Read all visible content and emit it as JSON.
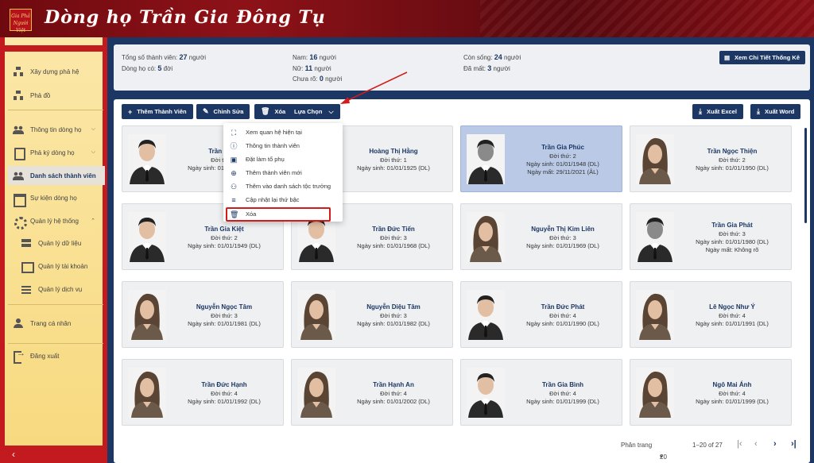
{
  "header": {
    "logo_text": "Gia Phả Người Việt",
    "title": "Dòng họ Trần Gia Đông Tụ"
  },
  "sidebar": {
    "items": [
      {
        "label": "Xây dựng phả hệ",
        "icon": "tree-icon"
      },
      {
        "label": "Phả đồ",
        "icon": "tree-icon"
      },
      {
        "label": "Thông tin dòng họ",
        "icon": "people-icon"
      },
      {
        "label": "Phả ký dòng họ",
        "icon": "book-icon"
      },
      {
        "label": "Danh sách thành viên",
        "icon": "people-icon"
      },
      {
        "label": "Sự kiện dòng họ",
        "icon": "calendar-icon"
      },
      {
        "label": "Quản lý hệ thống",
        "icon": "gear-icon"
      },
      {
        "label": "Quản lý dữ liệu",
        "icon": "server-icon"
      },
      {
        "label": "Quản lý tài khoản",
        "icon": "card-icon"
      },
      {
        "label": "Quản lý dịch vụ",
        "icon": "list-icon"
      },
      {
        "label": "Trang cá nhân",
        "icon": "user-icon"
      },
      {
        "label": "Đăng xuất",
        "icon": "logout-icon"
      }
    ],
    "active": "Danh sách thành viên"
  },
  "stats": {
    "total_label": "Tổng số thành viên:",
    "total_value": "27",
    "total_unit": "người",
    "gen_label": "Dòng họ có:",
    "gen_value": "5",
    "gen_unit": "đời",
    "male_label": "Nam:",
    "male_value": "16",
    "male_unit": "người",
    "female_label": "Nữ:",
    "female_value": "11",
    "female_unit": "người",
    "unknown_label": "Chưa rõ:",
    "unknown_value": "0",
    "unknown_unit": "người",
    "alive_label": "Còn sống:",
    "alive_value": "24",
    "alive_unit": "người",
    "dead_label": "Đã mất:",
    "dead_value": "3",
    "dead_unit": "người",
    "detail_button": "Xem Chi Tiết Thống Kê"
  },
  "toolbar": {
    "add": "Thêm Thành Viên",
    "edit": "Chỉnh Sửa",
    "delete": "Xóa",
    "options": "Lựa Chọn",
    "export_excel": "Xuất Excel",
    "export_word": "Xuất Word"
  },
  "dropdown": {
    "items": [
      "Xem quan hệ hiện tại",
      "Thông tin thành viên",
      "Đặt làm tổ phụ",
      "Thêm thành viên mới",
      "Thêm vào danh sách tộc trưởng",
      "Cập nhật lại thứ bậc",
      "Xóa"
    ],
    "highlighted": "Xóa"
  },
  "members": [
    {
      "name": "Trần Hùng",
      "gen": "Đời thứ: 1",
      "birth": "Ngày sinh: 01/01/1925 (DL)",
      "death": "",
      "gender": "male",
      "selected": false
    },
    {
      "name": "Hoàng Thị Hằng",
      "gen": "Đời thứ: 1",
      "birth": "Ngày sinh: 01/01/1925 (DL)",
      "death": "",
      "gender": "female",
      "selected": false
    },
    {
      "name": "Trần Gia Phúc",
      "gen": "Đời thứ: 2",
      "birth": "Ngày sinh: 01/01/1948 (DL)",
      "death": "Ngày mất: 29/11/2021 (ÂL)",
      "gender": "male-dead",
      "selected": true
    },
    {
      "name": "Trần Ngọc Thiện",
      "gen": "Đời thứ: 2",
      "birth": "Ngày sinh: 01/01/1950 (DL)",
      "death": "",
      "gender": "female",
      "selected": false
    },
    {
      "name": "Trần Gia Kiệt",
      "gen": "Đời thứ: 2",
      "birth": "Ngày sinh: 01/01/1949 (DL)",
      "death": "",
      "gender": "male",
      "selected": false
    },
    {
      "name": "Trần Đức Tiến",
      "gen": "Đời thứ: 3",
      "birth": "Ngày sinh: 01/01/1968 (DL)",
      "death": "",
      "gender": "male",
      "selected": false
    },
    {
      "name": "Nguyễn Thị Kim Liên",
      "gen": "Đời thứ: 3",
      "birth": "Ngày sinh: 01/01/1969 (DL)",
      "death": "",
      "gender": "female",
      "selected": false
    },
    {
      "name": "Trần Gia Phát",
      "gen": "Đời thứ: 3",
      "birth": "Ngày sinh: 01/01/1980 (DL)",
      "death": "Ngày mất: Không rõ",
      "gender": "male-dead",
      "selected": false
    },
    {
      "name": "Nguyễn Ngọc Tâm",
      "gen": "Đời thứ: 3",
      "birth": "Ngày sinh: 01/01/1981 (DL)",
      "death": "",
      "gender": "female",
      "selected": false
    },
    {
      "name": "Nguyễn Diệu Tâm",
      "gen": "Đời thứ: 3",
      "birth": "Ngày sinh: 01/01/1982 (DL)",
      "death": "",
      "gender": "female",
      "selected": false
    },
    {
      "name": "Trần Đức Phát",
      "gen": "Đời thứ: 4",
      "birth": "Ngày sinh: 01/01/1990 (DL)",
      "death": "",
      "gender": "male",
      "selected": false
    },
    {
      "name": "Lê Ngọc Như Ý",
      "gen": "Đời thứ: 4",
      "birth": "Ngày sinh: 01/01/1991 (DL)",
      "death": "",
      "gender": "female",
      "selected": false
    },
    {
      "name": "Trần Đức Hạnh",
      "gen": "Đời thứ: 4",
      "birth": "Ngày sinh: 01/01/1992 (DL)",
      "death": "",
      "gender": "female",
      "selected": false
    },
    {
      "name": "Trần Hạnh An",
      "gen": "Đời thứ: 4",
      "birth": "Ngày sinh: 01/01/2002 (DL)",
      "death": "",
      "gender": "female",
      "selected": false
    },
    {
      "name": "Trần Gia Bình",
      "gen": "Đời thứ: 4",
      "birth": "Ngày sinh: 01/01/1999 (DL)",
      "death": "",
      "gender": "male",
      "selected": false
    },
    {
      "name": "Ngô Mai Ánh",
      "gen": "Đời thứ: 4",
      "birth": "Ngày sinh: 01/01/1999 (DL)",
      "death": "",
      "gender": "female",
      "selected": false
    }
  ],
  "pager": {
    "label": "Phân trang",
    "size": "20",
    "range": "1–20 of 27"
  }
}
